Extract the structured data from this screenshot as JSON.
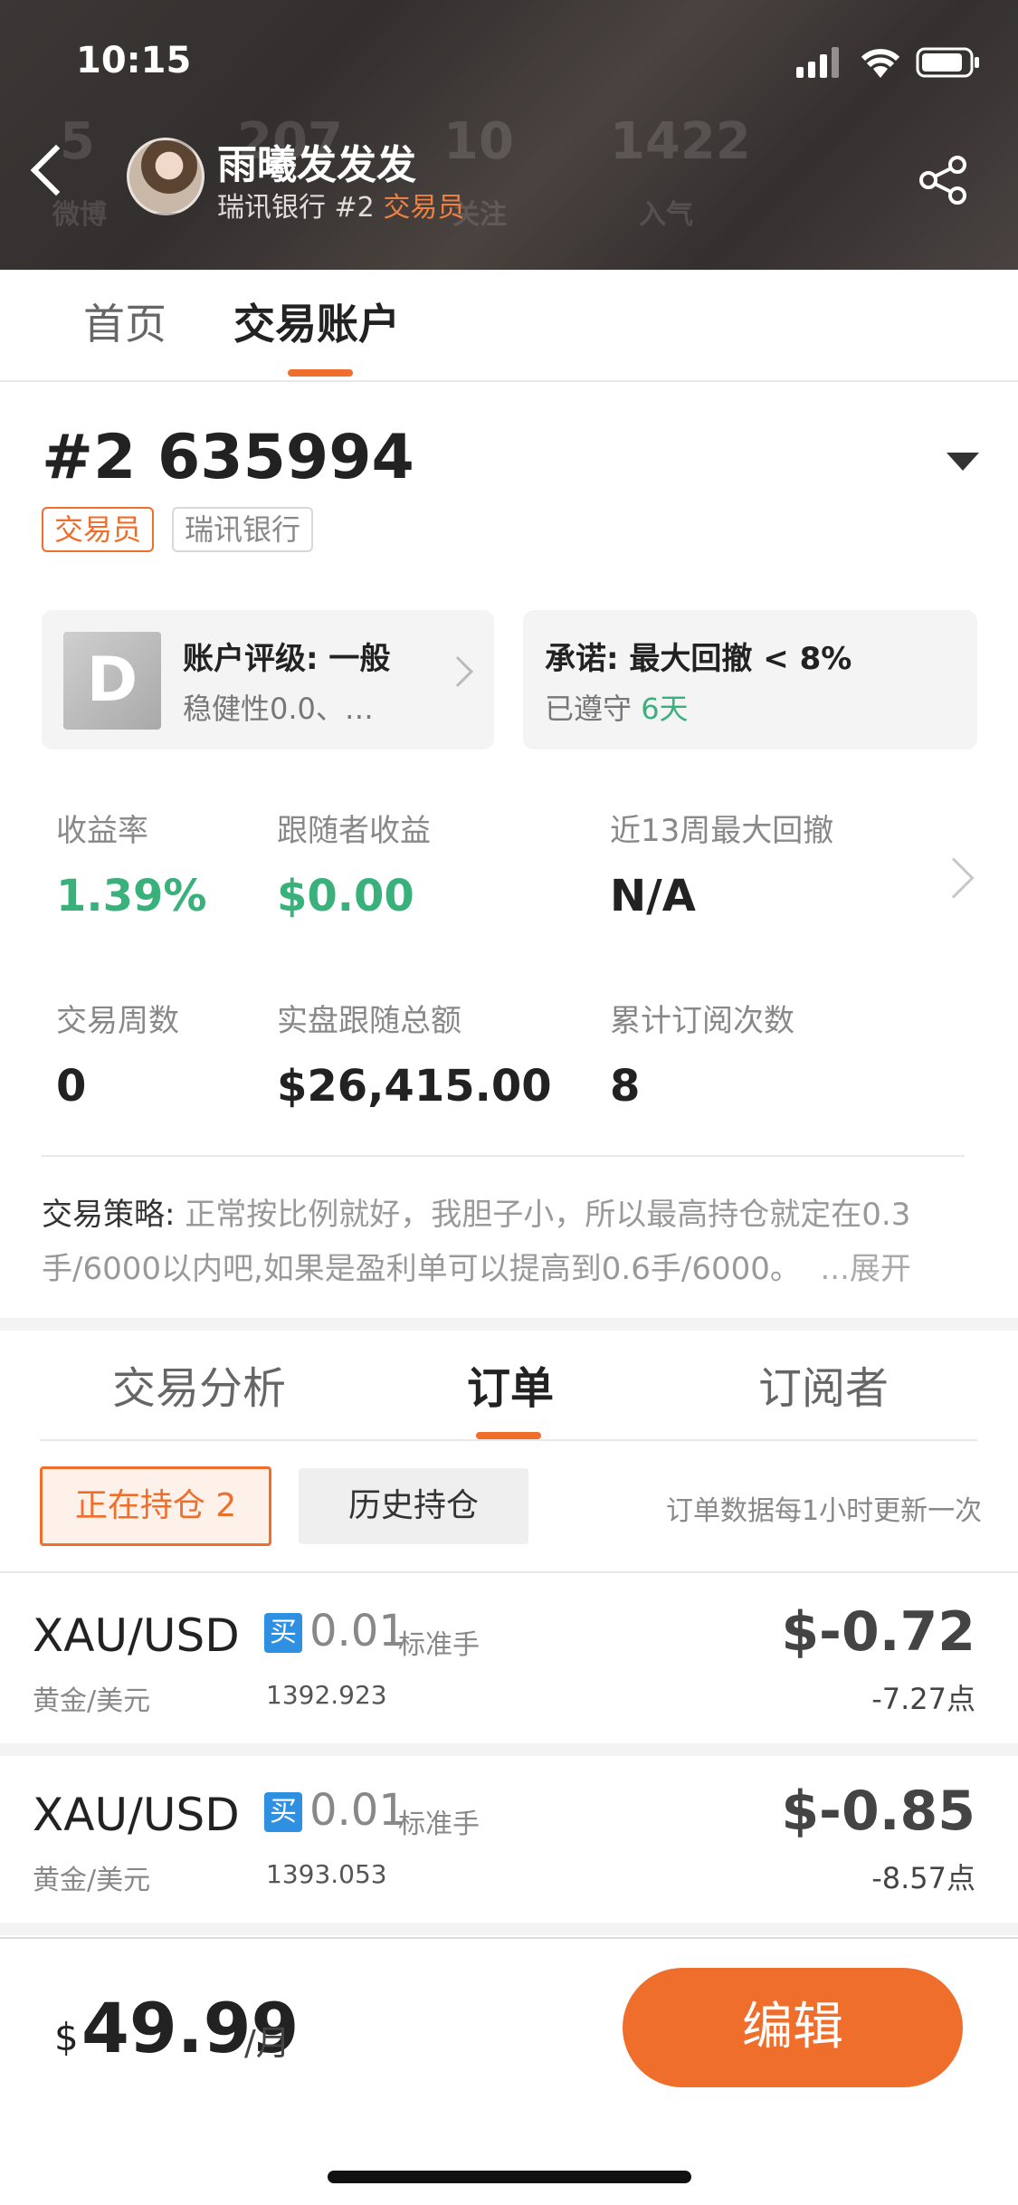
{
  "status_bar": {
    "time": "10:15"
  },
  "header": {
    "user_name": "雨曦发发发",
    "bank": "瑞讯银行",
    "rank": "#2",
    "role": "交易员",
    "ghost_stats": [
      "5",
      "207",
      "10",
      "1422"
    ],
    "ghost_labels": [
      "微博",
      "关注",
      "入气"
    ]
  },
  "top_tabs": [
    {
      "label": "首页"
    },
    {
      "label": "交易账户"
    }
  ],
  "account": {
    "id": "#2 635994",
    "tags": [
      "交易员",
      "瑞讯银行"
    ],
    "grade_letter": "D",
    "grade_title": "账户评级: 一般",
    "grade_sub": "稳健性0.0、…",
    "pledge_title": "承诺: 最大回撤 < 8%",
    "pledge_sub_prefix": "已遵守 ",
    "pledge_days": "6天"
  },
  "stats": {
    "return_label": "收益率",
    "return_value": "1.39%",
    "follower_label": "跟随者收益",
    "follower_value": "$0.00",
    "drawdown_label": "近13周最大回撤",
    "drawdown_value": "N/A",
    "weeks_label": "交易周数",
    "weeks_value": "0",
    "follow_total_label": "实盘跟随总额",
    "follow_total_value": "$26,415.00",
    "subs_label": "累计订阅次数",
    "subs_value": "8"
  },
  "strategy": {
    "label": "交易策略:",
    "text": " 正常按比例就好，我胆子小，所以最高持仓就定在0.3手/6000以内吧,如果是盈利单可以提高到0.6手/6000。",
    "more": "...展开"
  },
  "sub_tabs": [
    {
      "label": "交易分析"
    },
    {
      "label": "订单"
    },
    {
      "label": "订阅者"
    }
  ],
  "orders_header": {
    "holding_label": "正在持仓 2",
    "history_label": "历史持仓",
    "update_note": "订单数据每1小时更新一次"
  },
  "orders": [
    {
      "symbol": "XAU/USD",
      "symbol_cn": "黄金/美元",
      "side": "买",
      "lot": "0.01",
      "lot_unit": "标准手",
      "price": "1392.923",
      "pnl": "$-0.72",
      "points": "-7.27点"
    },
    {
      "symbol": "XAU/USD",
      "symbol_cn": "黄金/美元",
      "side": "买",
      "lot": "0.01",
      "lot_unit": "标准手",
      "price": "1393.053",
      "pnl": "$-0.85",
      "points": "-8.57点"
    }
  ],
  "bottom": {
    "currency": "$",
    "price": "49.99",
    "per": "/月",
    "edit_label": "编辑"
  },
  "colors": {
    "accent": "#ef6e2c",
    "positive": "#3ab07b",
    "buy": "#2f8fe0"
  }
}
